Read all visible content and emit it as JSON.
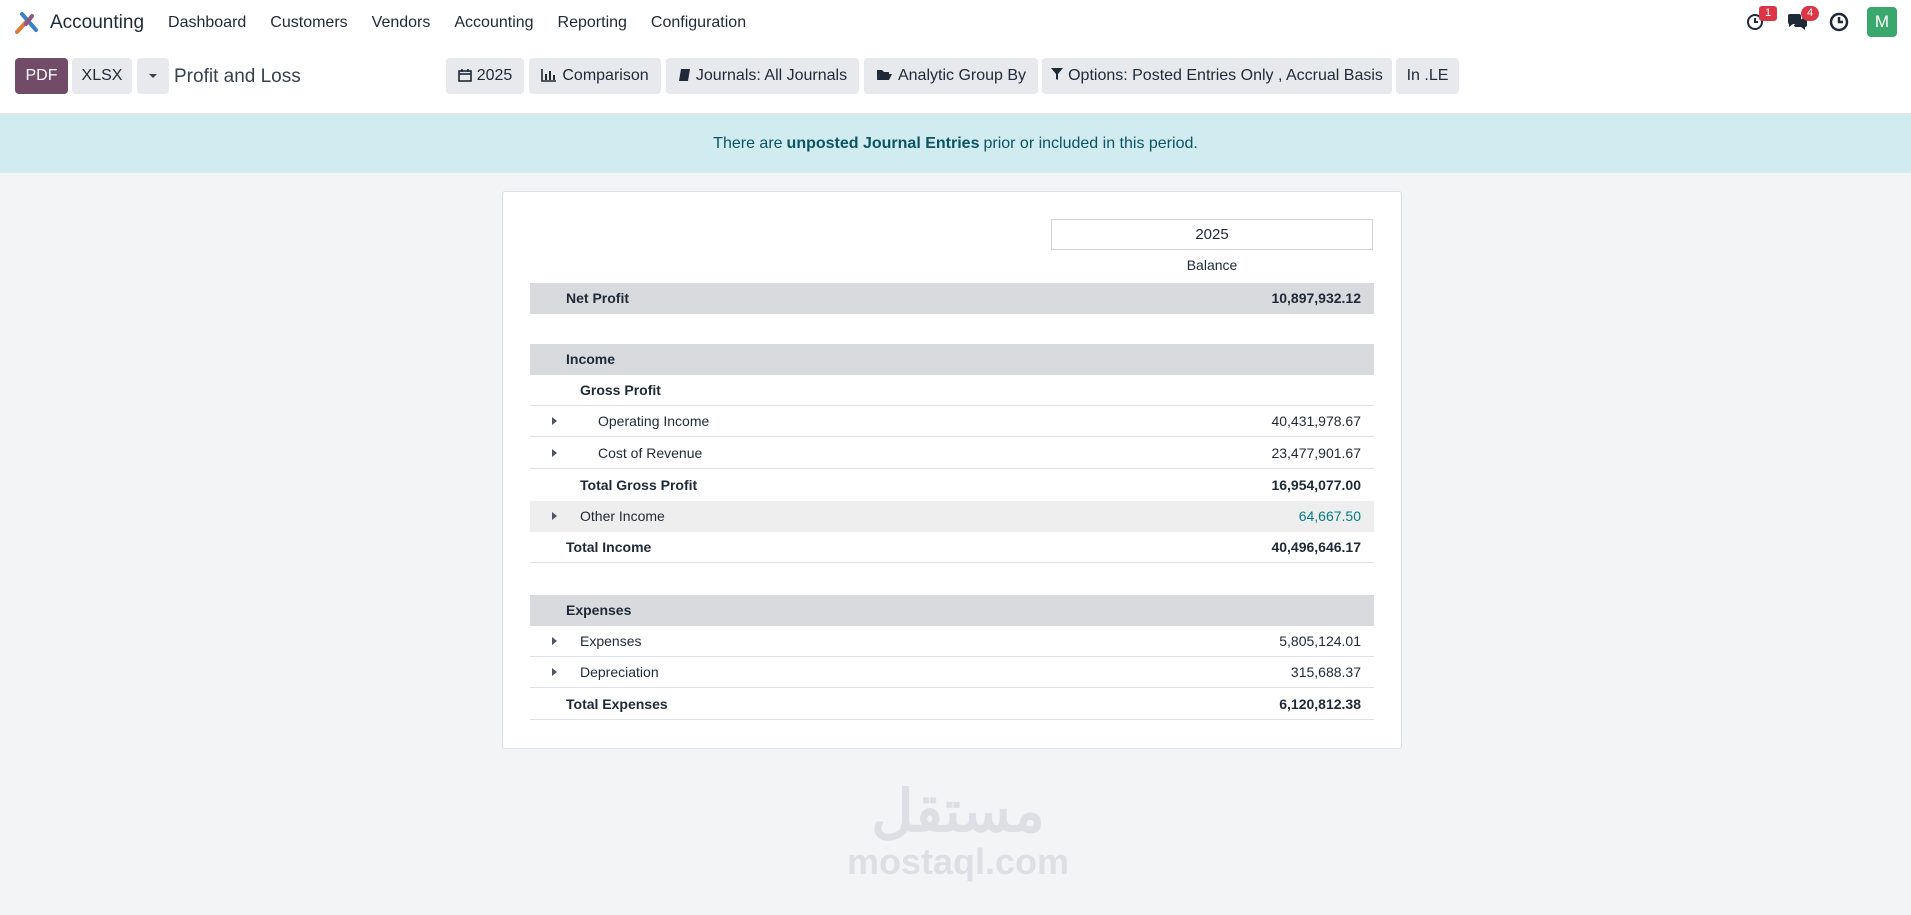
{
  "app": {
    "name": "Accounting"
  },
  "nav": {
    "menu": [
      "Dashboard",
      "Customers",
      "Vendors",
      "Accounting",
      "Reporting",
      "Configuration"
    ],
    "activity_badge": "1",
    "messages_badge": "4",
    "avatar_letter": "M"
  },
  "toolbar": {
    "pdf": "PDF",
    "xlsx": "XLSX",
    "title": "Profit and Loss",
    "filters": {
      "date": "2025",
      "comparison": "Comparison",
      "journals": "Journals: All Journals",
      "analytic": "Analytic Group By",
      "options": "Options: Posted Entries Only , Accrual Basis",
      "currency": "In .LE"
    }
  },
  "alert": {
    "prefix": "There are",
    "link": "unposted Journal Entries",
    "suffix": "prior or included in this period."
  },
  "report": {
    "column_year": "2025",
    "column_label": "Balance",
    "rows": [
      {
        "label": "Net Profit",
        "value": "10,897,932.12"
      },
      {
        "label": "Income",
        "value": ""
      },
      {
        "label": "Gross Profit",
        "value": ""
      },
      {
        "label": "Operating Income",
        "value": "40,431,978.67"
      },
      {
        "label": "Cost of Revenue",
        "value": "23,477,901.67"
      },
      {
        "label": "Total Gross Profit",
        "value": "16,954,077.00"
      },
      {
        "label": "Other Income",
        "value": "64,667.50"
      },
      {
        "label": "Total Income",
        "value": "40,496,646.17"
      },
      {
        "label": "Expenses",
        "value": ""
      },
      {
        "label": "Expenses",
        "value": "5,805,124.01"
      },
      {
        "label": "Depreciation",
        "value": "315,688.37"
      },
      {
        "label": "Total Expenses",
        "value": "6,120,812.38"
      }
    ]
  },
  "watermark": {
    "arabic": "مستقل",
    "latin": "mostaql.com"
  }
}
